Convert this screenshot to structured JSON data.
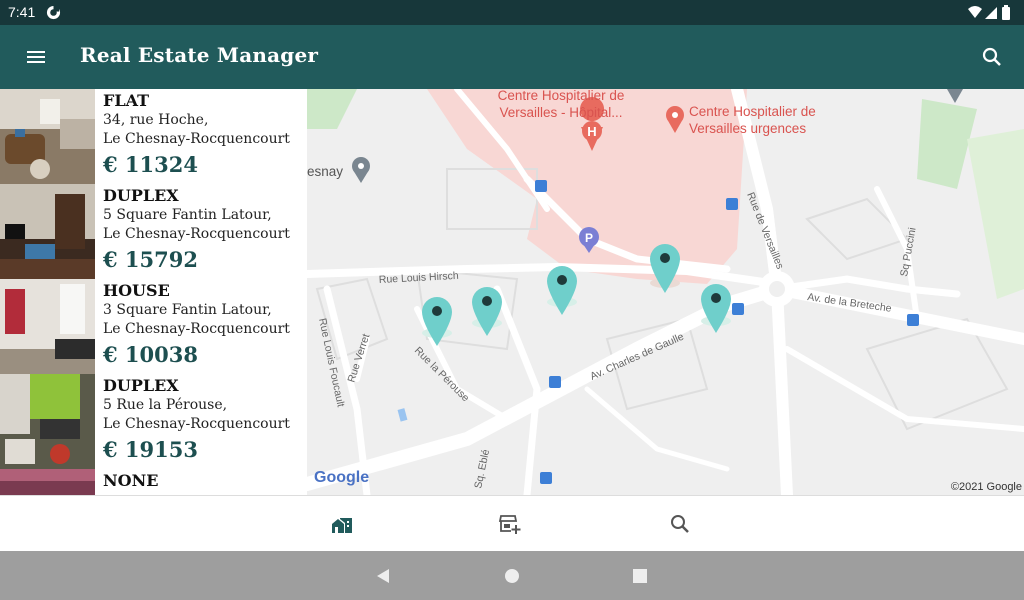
{
  "status_bar": {
    "time": "7:41"
  },
  "app_bar": {
    "title": "Real Estate Manager"
  },
  "properties": [
    {
      "type": "FLAT",
      "address_line1": "34, rue Hoche,",
      "address_line2": "Le Chesnay-Rocquencourt",
      "price": "€ 11324"
    },
    {
      "type": "DUPLEX",
      "address_line1": "5 Square Fantin Latour,",
      "address_line2": "Le Chesnay-Rocquencourt",
      "price": "€ 15792"
    },
    {
      "type": "HOUSE",
      "address_line1": "3 Square Fantin Latour,",
      "address_line2": "Le Chesnay-Rocquencourt",
      "price": "€ 10038"
    },
    {
      "type": "DUPLEX",
      "address_line1": "5 Rue la Pérouse,",
      "address_line2": "Le Chesnay-Rocquencourt",
      "price": "€ 19153"
    },
    {
      "type": "NONE",
      "address_line1": "",
      "address_line2": "",
      "price": ""
    }
  ],
  "map": {
    "labels": {
      "hospital": "Centre Hospitalier de",
      "hospital2": "Versailles - Hôpital...",
      "urgences": "Centre Hospitalier de",
      "urgences2": "Versailles urgences",
      "place": "esnay",
      "rue_louis_hirsch": "Rue Louis Hirsch",
      "rue_de_versailles": "Rue de Versailles",
      "sq_puccini": "Sq Puccini",
      "av_breteche": "Av. de la Breteche",
      "av_charles": "Av. Charles de Gaulle",
      "rue_foucault": "Rue Louis Foucault",
      "rue_verret": "Rue Verret",
      "rue_perouse": "Rue la Pérouse",
      "sq_eble": "Sq. Eblé"
    },
    "google_logo": "Google",
    "copyright": "©2021 Google"
  },
  "bottom_nav": {
    "icons": [
      "home-city-icon",
      "add-property-icon",
      "search-icon"
    ]
  },
  "colors": {
    "status_bar": "#17373a",
    "app_bar": "#215b5c",
    "price": "#1d4f50",
    "marker": "#6fcfcb",
    "hospital_zone": "#f8d7d4"
  }
}
